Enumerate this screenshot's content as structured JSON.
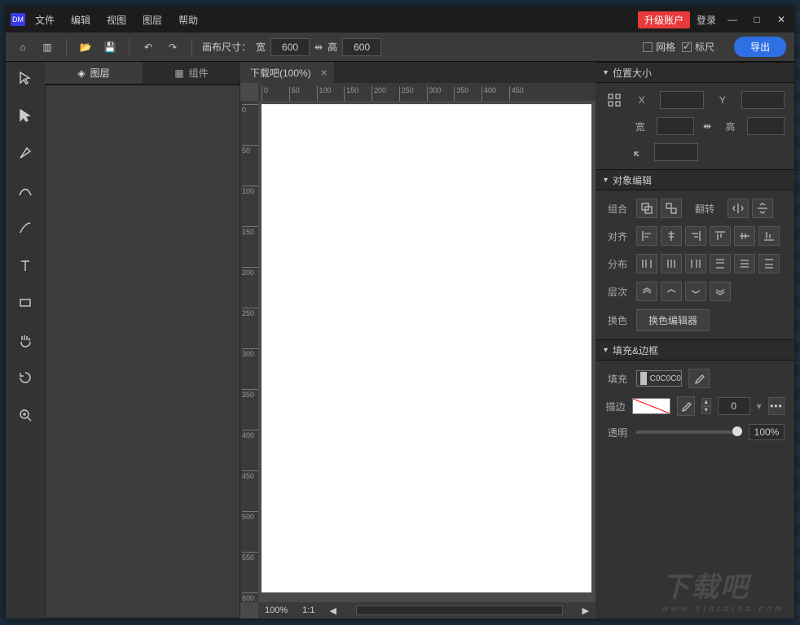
{
  "logo": "DM",
  "menu": {
    "file": "文件",
    "edit": "编辑",
    "view": "视图",
    "layer": "图层",
    "help": "帮助"
  },
  "titlebar": {
    "upgrade": "升级账户",
    "login": "登录"
  },
  "toolbar": {
    "canvasSize": "画布尺寸：",
    "w": "宽",
    "wval": "600",
    "h": "高",
    "hval": "600",
    "grid": "网格",
    "ruler": "标尺",
    "export": "导出"
  },
  "leftTabs": {
    "layers": "图层",
    "components": "组件"
  },
  "docTab": {
    "name": "下载吧(100%)"
  },
  "status": {
    "zoom": "100%",
    "ratio": "1:1"
  },
  "rulerH": [
    0,
    50,
    100,
    150,
    200,
    250,
    300,
    350,
    400,
    450
  ],
  "rulerV": [
    0,
    50,
    100,
    150,
    200,
    250,
    300,
    350,
    400,
    450,
    500,
    550,
    600
  ],
  "panels": {
    "posSize": {
      "title": "位置大小",
      "x": "X",
      "y": "Y",
      "w": "宽",
      "h": "高"
    },
    "objEdit": {
      "title": "对象编辑",
      "group": "组合",
      "flip": "翻转",
      "align": "对齐",
      "distribute": "分布",
      "layer": "层次",
      "recolor": "换色",
      "recolorBtn": "换色编辑器"
    },
    "fillStroke": {
      "title": "填充&边框",
      "fill": "填充",
      "fillVal": "C0C0C0",
      "stroke": "描边",
      "strokeW": "0",
      "opacity": "透明",
      "opacityVal": "100%"
    }
  },
  "watermark": {
    "big": "下载吧",
    "small": "www.xiazaiba.com"
  }
}
